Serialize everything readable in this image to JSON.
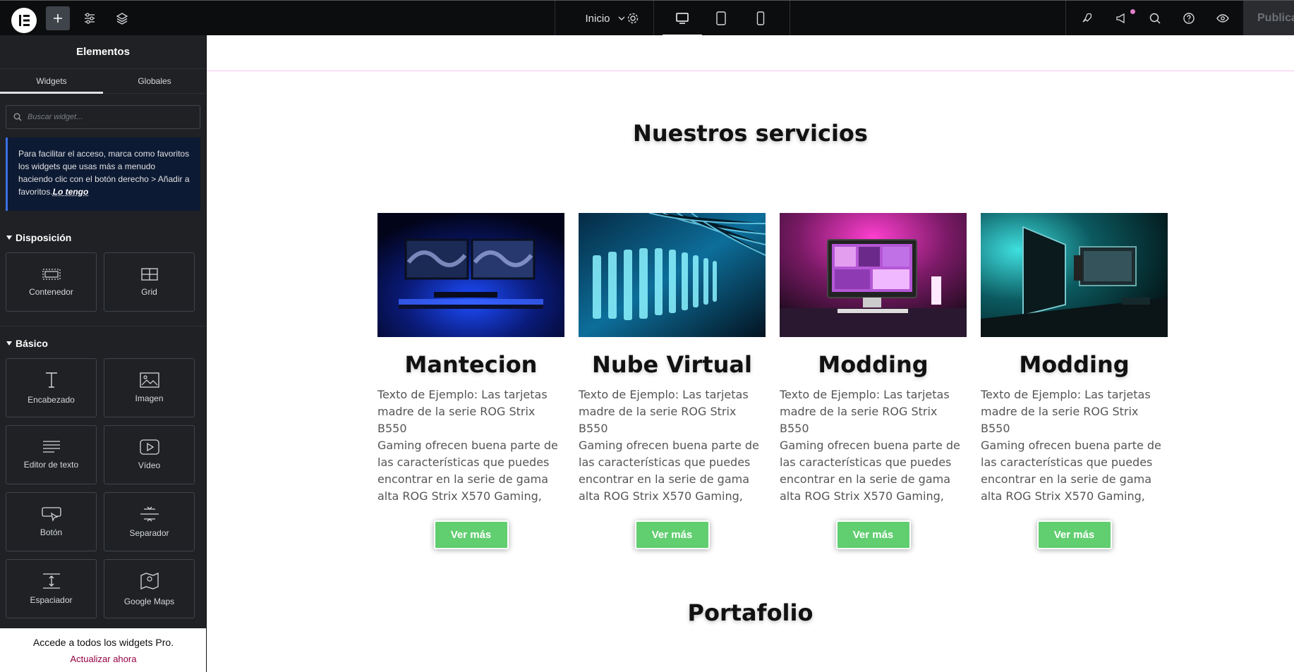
{
  "topbar": {
    "page_label": "Inicio",
    "publish_label": "Publicar"
  },
  "sidebar": {
    "title": "Elementos",
    "tabs": [
      {
        "label": "Widgets",
        "active": true
      },
      {
        "label": "Globales",
        "active": false
      }
    ],
    "search_placeholder": "Buscar widget...",
    "tip_text": "Para facilitar el acceso, marca como favoritos los widgets que usas más a menudo haciendo clic con el botón derecho > Añadir a favoritos.",
    "tip_link": "Lo tengo",
    "sections": [
      {
        "title": "Disposición",
        "widgets": [
          {
            "label": "Contenedor",
            "icon": "container-icon"
          },
          {
            "label": "Grid",
            "icon": "grid-icon"
          }
        ]
      },
      {
        "title": "Básico",
        "widgets": [
          {
            "label": "Encabezado",
            "icon": "heading-icon"
          },
          {
            "label": "Imagen",
            "icon": "image-icon"
          },
          {
            "label": "Editor de texto",
            "icon": "text-editor-icon"
          },
          {
            "label": "Vídeo",
            "icon": "video-icon"
          },
          {
            "label": "Botón",
            "icon": "button-icon"
          },
          {
            "label": "Separador",
            "icon": "divider-icon"
          },
          {
            "label": "Espaciador",
            "icon": "spacer-icon"
          },
          {
            "label": "Google Maps",
            "icon": "map-icon"
          }
        ]
      }
    ],
    "upgrade_title": "Accede a todos los widgets Pro.",
    "upgrade_link": "Actualizar ahora"
  },
  "canvas": {
    "services_heading": "Nuestros servicios",
    "portfolio_heading": "Portafolio",
    "cards": [
      {
        "title": "Mantecion",
        "text": "Texto de Ejemplo: Las tarjetas\nmadre de la serie ROG Strix B550\nGaming ofrecen buena parte de\nlas características que puedes\nencontrar en la serie de gama\nalta ROG Strix X570 Gaming,",
        "button": "Ver más",
        "image": "gaming-setup-blue"
      },
      {
        "title": "Nube Virtual",
        "text": "Texto de Ejemplo: Las tarjetas\nmadre de la serie ROG Strix B550\nGaming ofrecen buena parte de\nlas características que puedes\nencontrar en la serie de gama\nalta ROG Strix X570 Gaming,",
        "button": "Ver más",
        "image": "server-rack-cyan"
      },
      {
        "title": "Modding",
        "text": "Texto de Ejemplo: Las tarjetas\nmadre de la serie ROG Strix B550\nGaming ofrecen buena parte de\nlas características que puedes\nencontrar en la serie de gama\nalta ROG Strix X570 Gaming,",
        "button": "Ver más",
        "image": "desk-setup-pink"
      },
      {
        "title": "Modding",
        "text": "Texto de Ejemplo: Las tarjetas\nmadre de la serie ROG Strix B550\nGaming ofrecen buena parte de\nlas características que puedes\nencontrar en la serie de gama\nalta ROG Strix X570 Gaming,",
        "button": "Ver más",
        "image": "desk-setup-teal"
      }
    ]
  },
  "colors": {
    "button_green": "#61ce70",
    "sidebar_bg": "#1f2124",
    "topbar_bg": "#0c0d0e",
    "tip_accent": "#3b6fe2",
    "upgrade_link": "#93003f"
  }
}
